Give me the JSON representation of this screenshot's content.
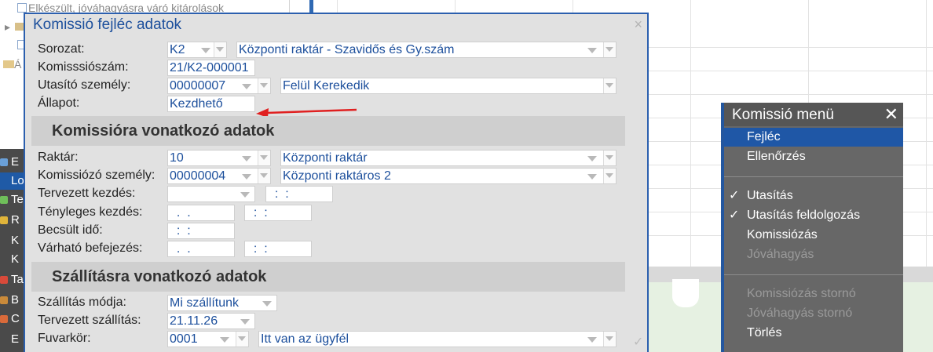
{
  "background": {
    "tree_rows": [
      "Elkészült, jóváhagyásra váró kitárolások",
      "",
      "",
      "Á"
    ],
    "nav_letters": [
      "E",
      "Lo",
      "Te",
      "R",
      "K",
      "K",
      "Ta",
      "B",
      "C",
      "E"
    ]
  },
  "dialog": {
    "title": "Komissió fejléc adatok",
    "close_glyph": "×",
    "fields": {
      "sorozat": {
        "label": "Sorozat:",
        "code": "K2",
        "name": "Központi raktár - Szavidős és Gy.szám"
      },
      "komissioszam": {
        "label": "Komisssiószám:",
        "value": "21/K2-000001"
      },
      "utasito": {
        "label": "Utasító személy:",
        "code": "00000007",
        "name": "Felül Kerekedik"
      },
      "allapot": {
        "label": "Állapot:",
        "value": "Kezdhető"
      }
    },
    "section1": {
      "title": "Komissióra vonatkozó adatok",
      "raktar": {
        "label": "Raktár:",
        "code": "10",
        "name": "Központi raktár"
      },
      "komissiozo": {
        "label": "Komissiózó személy:",
        "code": "00000004",
        "name": "Központi raktáros 2"
      },
      "tervezett_kezdes": {
        "label": "Tervezett kezdés:",
        "date": "  .  .",
        "time": "  :  :"
      },
      "tenyleges_kezdes": {
        "label": "Tényleges kezdés:",
        "date": "  .  .",
        "time": "  :  :"
      },
      "becsult_ido": {
        "label": "Becsült idő:",
        "time": "  :  :"
      },
      "varhato_befejezes": {
        "label": "Várható befejezés:",
        "date": "  .  .",
        "time": "  :  :"
      }
    },
    "section2": {
      "title": "Szállításra vonatkozó adatok",
      "szallitas_modja": {
        "label": "Szállítás módja:",
        "value": "Mi szállítunk"
      },
      "tervezett_szallitas": {
        "label": "Tervezett szállítás:",
        "value": "21.11.26"
      },
      "fuvarkor": {
        "label": "Fuvarkör:",
        "code": "0001",
        "name": "Itt van az ügyfél"
      }
    },
    "confirm_glyph": "✓",
    "annotation_color": "#e02020"
  },
  "menu": {
    "title": "Komissió menü",
    "close_glyph": "✕",
    "items": [
      {
        "label": "Fejléc",
        "selected": true
      },
      {
        "label": "Ellenőrzés"
      },
      {
        "label": "Utasítás",
        "checked": true
      },
      {
        "label": "Utasítás feldolgozás",
        "checked": true
      },
      {
        "label": "Komissiózás"
      },
      {
        "label": "Jóváhagyás",
        "disabled": true
      },
      {
        "label": "Komissiózás stornó",
        "disabled": true
      },
      {
        "label": "Jóváhagyás stornó",
        "disabled": true
      },
      {
        "label": "Törlés"
      }
    ],
    "check_glyph": "✓"
  },
  "colors": {
    "accent_blue": "#2b5fae",
    "field_text": "#1c4f9c",
    "menu_bg": "#676767",
    "menu_selected": "#1f57a6"
  }
}
